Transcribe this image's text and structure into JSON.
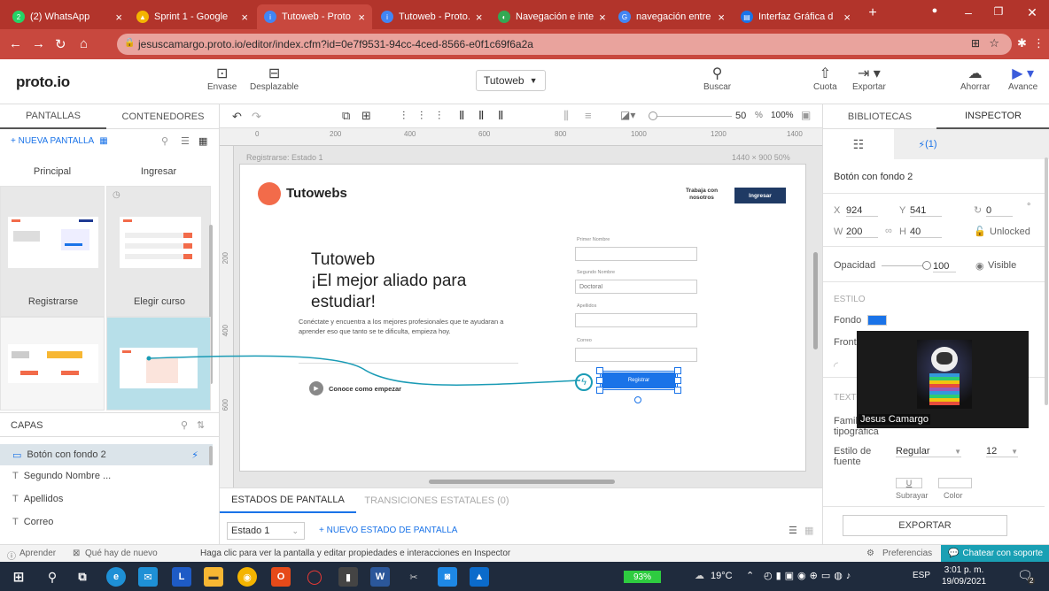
{
  "browser": {
    "tabs": [
      {
        "label": "(2) WhatsApp",
        "color": "#25d366",
        "glyph": "2"
      },
      {
        "label": "Sprint 1 - Google",
        "color": "#f4b400",
        "glyph": "▲"
      },
      {
        "label": "Tutoweb - Proto",
        "color": "#4285f4",
        "glyph": "i"
      },
      {
        "label": "Tutoweb - Proto.",
        "color": "#4285f4",
        "glyph": "i"
      },
      {
        "label": "Navegación e inte",
        "color": "#34a853",
        "glyph": "◐"
      },
      {
        "label": "navegación entre",
        "color": "#4285f4",
        "glyph": "G"
      },
      {
        "label": "Interfaz Gráfica d",
        "color": "#1a73e8",
        "glyph": "▤"
      }
    ],
    "url": "jesuscamargo.proto.io/editor/index.cfm?id=0e7f9531-94cc-4ced-8566-e0f1c69f6a2a"
  },
  "app": {
    "logo": "proto.io",
    "tools": {
      "envase": "Envase",
      "desplazable": "Desplazable",
      "buscar": "Buscar",
      "cuota": "Cuota",
      "exportar": "Exportar",
      "ahorrar": "Ahorrar",
      "avance": "Avance"
    },
    "project_select": "Tutoweb"
  },
  "left": {
    "tab_pantallas": "PANTALLAS",
    "tab_contenedores": "CONTENEDORES",
    "new_screen": "+ NUEVA PANTALLA",
    "screens": [
      {
        "name": "Principal"
      },
      {
        "name": "Ingresar"
      },
      {
        "name": "Registrarse"
      },
      {
        "name": "Elegir curso"
      }
    ],
    "layers_title": "CAPAS",
    "layers": [
      {
        "name": "Botón con fondo 2"
      },
      {
        "name": "Segundo Nombre ..."
      },
      {
        "name": "Apellidos"
      },
      {
        "name": "Correo"
      }
    ]
  },
  "toolbar2": {
    "zoom": "50",
    "zoom_unit": "%",
    "zoom_full": "100%"
  },
  "ruler": [
    "0",
    "200",
    "400",
    "600",
    "800",
    "1000",
    "1200",
    "1400"
  ],
  "canvas": {
    "state_label": "Registrarse: Estado 1",
    "dims": "1440 × 900  50%",
    "site_brand": "Tutowebs",
    "nav_link": "Trabaja con nosotros",
    "nav_button": "Ingresar",
    "hero_title_1": "Tutoweb",
    "hero_title_2": "¡El mejor aliado para",
    "hero_title_3": "estudiar!",
    "hero_text": "Conéctate y encuentra a los mejores profesionales que te ayudaran a aprender eso que tanto se te dificulta, empieza hoy.",
    "cta": "Conoce como empezar",
    "form": {
      "primer_nombre": "Primer Nombre",
      "segundo_nombre": "Segundo Nombre",
      "segundo_placeholder": "Doctoral",
      "apellidos": "Apellidos",
      "correo": "Correo",
      "submit": "Registrar"
    },
    "vruler": [
      "200",
      "400",
      "600"
    ]
  },
  "state_tabs": {
    "tab1": "ESTADOS DE PANTALLA",
    "tab2": "TRANSICIONES ESTATALES (0)",
    "state_select": "Estado 1",
    "new_state": "+ NUEVO ESTADO DE PANTALLA"
  },
  "right": {
    "tab_bibliotecas": "BIBLIOTECAS",
    "tab_inspector": "INSPECTOR",
    "interactions_count": "(1)",
    "element_name": "Botón con fondo 2",
    "x_label": "X",
    "x": "924",
    "y_label": "Y",
    "y": "541",
    "rot": "0",
    "rot_unit": "°",
    "w_label": "W",
    "w": "200",
    "h_label": "H",
    "h": "40",
    "unlocked": "Unlocked",
    "opacity_label": "Opacidad",
    "opacity": "100",
    "visible": "Visible",
    "estilo": "ESTILO",
    "fondo": "Fondo",
    "fondo_color": "#1a73e8",
    "frontera": "Fronte",
    "texto": "TEXTO",
    "familia": "Famil",
    "tipografica": "tipográfica",
    "estilo_fuente": "Estilo de fuente",
    "regular": "Regular",
    "font_size": "12",
    "subrayar": "Subrayar",
    "color": "Color",
    "exportar": "EXPORTAR",
    "video_name": "Jesus Camargo"
  },
  "status": {
    "aprender": "Aprender",
    "que_hay": "Qué hay de nuevo",
    "hint": "Haga clic para ver la pantalla y editar propiedades e interacciones en Inspector",
    "preferencias": "Preferencias",
    "chat": "Chatear con soporte"
  },
  "taskbar": {
    "battery": "93%",
    "temp": "19°C",
    "lang": "ESP",
    "time": "3:01 p. m.",
    "date": "19/09/2021",
    "notif": "2"
  }
}
